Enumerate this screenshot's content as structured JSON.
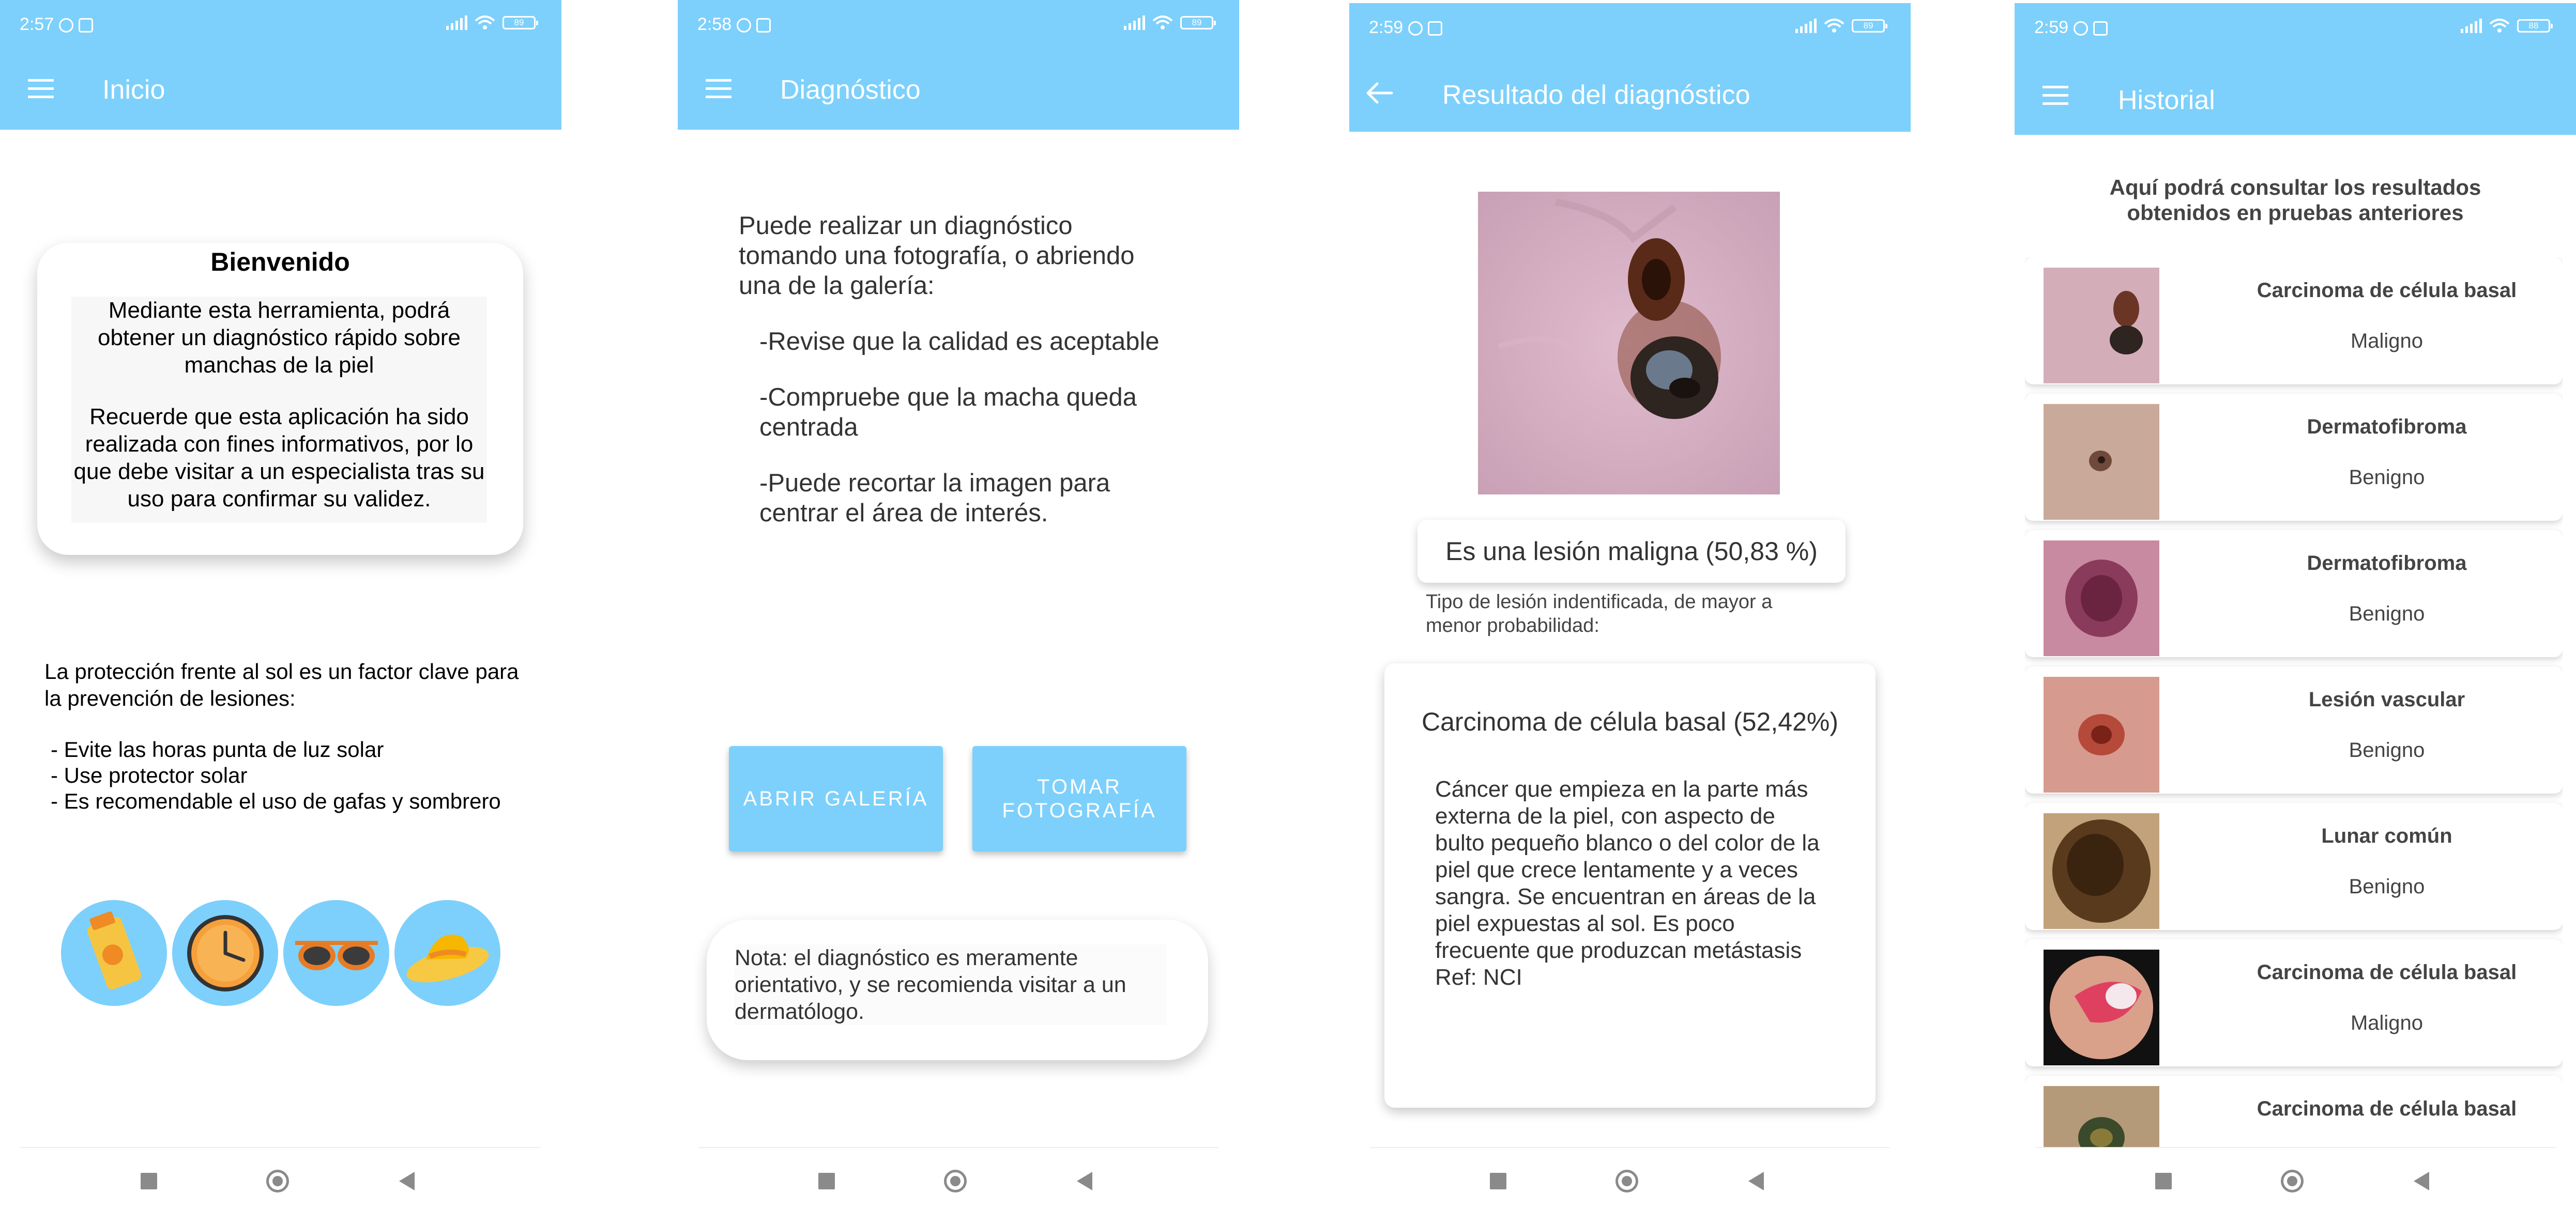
{
  "colors": {
    "appbar": "#7dd0fb",
    "accent": "#7dd0fb",
    "nav_gray": "#8a8a8a"
  },
  "screens": [
    {
      "status": {
        "time": "2:57",
        "battery": "89"
      },
      "appbar": {
        "nav_icon": "hamburger-icon",
        "title": "Inicio"
      },
      "welcome": {
        "title": "Bienvenido",
        "paragraph1": "Mediante esta herramienta, podrá obtener un diagnóstico rápido sobre manchas de la piel",
        "paragraph2": "Recuerde que esta aplicación ha sido realizada con fines informativos, por lo que debe visitar a un especialista tras su uso para confirmar su validez."
      },
      "sun_protection": {
        "intro": "La protección frente al sol es un factor clave para la prevención de lesiones:",
        "tips": [
          "- Evite las horas punta de luz solar",
          "- Use protector solar",
          "- Es recomendable el uso de gafas y sombrero"
        ]
      },
      "icons": [
        "sunscreen-icon",
        "clock-icon",
        "sunglasses-icon",
        "sun-hat-icon"
      ]
    },
    {
      "status": {
        "time": "2:58",
        "battery": "89"
      },
      "appbar": {
        "nav_icon": "hamburger-icon",
        "title": "Diagnóstico"
      },
      "instructions": {
        "intro": "Puede realizar un diagnóstico tomando una fotografía, o abriendo una de la galería:",
        "steps": [
          "-Revise que la calidad es aceptable",
          "-Compruebe que la macha queda centrada",
          "-Puede recortar la imagen para centrar el área de interés."
        ]
      },
      "buttons": {
        "gallery": "ABRIR GALERÍA",
        "photo": "TOMAR FOTOGRAFÍA"
      },
      "note": "Nota: el diagnóstico es meramente orientativo, y se recomienda visitar a un dermatólogo."
    },
    {
      "status": {
        "time": "2:59",
        "battery": "89"
      },
      "appbar": {
        "nav_icon": "back-arrow-icon",
        "title": "Resultado del diagnóstico"
      },
      "result": "Es una lesión maligna (50,83 %)",
      "subtitle": "Tipo de lesión indentificada, de mayor a menor probabilidad:",
      "top_lesion": {
        "name": "Carcinoma de célula basal (52,42%)",
        "description": "Cáncer que empieza en la parte más externa de la piel, con aspecto de bulto pequeño blanco o del color de la piel que crece lentamente y a veces sangra. Se encuentran en áreas de la piel expuestas al sol. Es poco frecuente que produzcan metástasis Ref: NCI"
      }
    },
    {
      "status": {
        "time": "2:59",
        "battery": "88"
      },
      "appbar": {
        "nav_icon": "hamburger-icon",
        "title": "Historial"
      },
      "intro": "Aquí podrá consultar los resultados obtenidos en pruebas anteriores",
      "history": [
        {
          "name": "Carcinoma de célula basal",
          "verdict": "Maligno"
        },
        {
          "name": "Dermatofibroma",
          "verdict": "Benigno"
        },
        {
          "name": "Dermatofibroma",
          "verdict": "Benigno"
        },
        {
          "name": "Lesión vascular",
          "verdict": "Benigno"
        },
        {
          "name": "Lunar común",
          "verdict": "Benigno"
        },
        {
          "name": "Carcinoma de célula basal",
          "verdict": "Maligno"
        },
        {
          "name": "Carcinoma de célula basal",
          "verdict": ""
        }
      ]
    }
  ]
}
